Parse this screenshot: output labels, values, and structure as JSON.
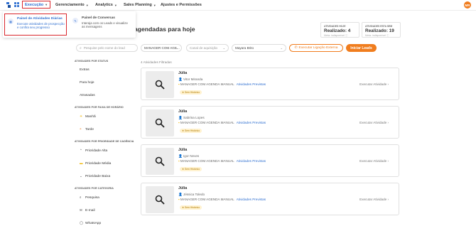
{
  "colors": {
    "primary": "#2f6fd0",
    "accent": "#f07d1e",
    "highlight": "#d9262c"
  },
  "topbar": {
    "menus": [
      "Execução",
      "Gerenciamento",
      "Analytics",
      "Sales Planning",
      "Ajustes e Permissões"
    ],
    "avatar_initials": "MR"
  },
  "dropdown": {
    "items": [
      {
        "title": "Painel de Atividades Diárias",
        "description": "Execute atividades de prospecção e confira seu progresso"
      },
      {
        "title": "Painel de Conversas",
        "description": "Interaja com os Leads e visualize as mensagens"
      }
    ]
  },
  "heading": "agendadas para hoje",
  "stats": [
    {
      "label": "ATIVIDADES HOJE",
      "value": "Realizado: 4",
      "sub": "Meta: indisponível"
    },
    {
      "label": "ATIVIDADES ESTA SEM",
      "value": "Realizado: 19",
      "sub": "Meta: indisponível"
    }
  ],
  "filters": {
    "search_placeholder": "Pesquise pelo nome do lead",
    "campaign": "MANAGER COM AGE...",
    "stage_placeholder": "Canal de aquisição",
    "owner": "Mayara Brito",
    "execute_button": "Executar Ligação Externa",
    "start_button": "Iniciar Leads"
  },
  "activity_count": "4 Atividades Filtradas",
  "sidebar": {
    "sections": [
      {
        "title": "ATIVIDADES POR STATUS",
        "items": [
          {
            "icon": "",
            "label": "Extras"
          },
          {
            "icon": "",
            "label": "Para hoje"
          },
          {
            "icon": "",
            "label": "Atrasadas"
          }
        ]
      },
      {
        "title": "ATIVIDADES POR FAIXA DE HORÁRIO",
        "items": [
          {
            "icon": "sun-icon",
            "label": "Manhã"
          },
          {
            "icon": "sunset-icon",
            "label": "Tarde"
          }
        ]
      },
      {
        "title": "ATIVIDADES POR PRIORIDADE DE CADÊNCIA",
        "items": [
          {
            "icon": "chevron-up-icon",
            "label": "Prioridade Alta"
          },
          {
            "icon": "equals-icon",
            "label": "Prioridade Média"
          },
          {
            "icon": "chevron-down-icon",
            "label": "Prioridade Baixa"
          }
        ]
      },
      {
        "title": "ATIVIDADES POR CATEGORIA",
        "items": [
          {
            "icon": "search-icon",
            "label": "Pesquisa"
          },
          {
            "icon": "mail-icon",
            "label": "E-mail"
          },
          {
            "icon": "whatsapp-icon",
            "label": "WhatsApp"
          }
        ]
      }
    ]
  },
  "cards": [
    {
      "name": "Júlia",
      "person": "Vitor Miranda",
      "campaign": "MANAGER COM AGENDA MANUAL",
      "link": "Atividades Previstas",
      "tag": "Sem Histórico",
      "action": "Executar Atividade"
    },
    {
      "name": "Júlia",
      "person": "Sabrina Lopes",
      "campaign": "MANAGER COM AGENDA MANUAL",
      "link": "Atividades Previstas",
      "tag": "Sem Histórico",
      "action": "Executar Atividade"
    },
    {
      "name": "Júlia",
      "person": "Igor Neves",
      "campaign": "MANAGER COM AGENDA MANUAL",
      "link": "Atividades Previstas",
      "tag": "Sem Histórico",
      "action": "Executar Atividade"
    },
    {
      "name": "Júlia",
      "person": "Jéssica Toledo",
      "campaign": "MANAGER COM AGENDA MANUAL",
      "link": "Atividades Previstas",
      "tag": "Sem Histórico",
      "action": "Executar Atividade"
    }
  ]
}
